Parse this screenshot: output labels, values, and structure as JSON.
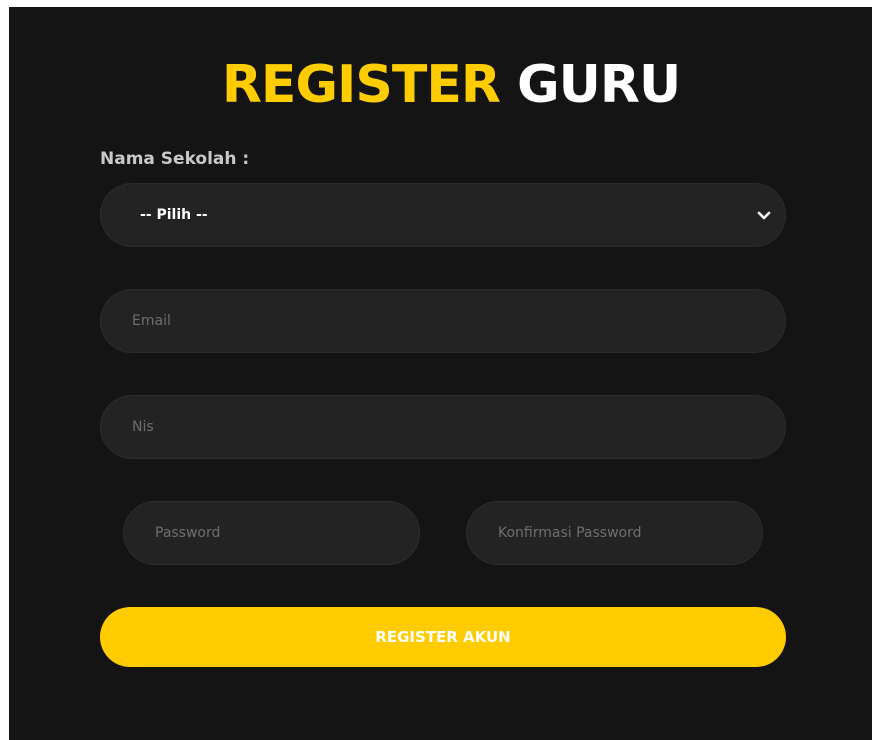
{
  "title": {
    "accent": "REGISTER",
    "rest": "GURU"
  },
  "form": {
    "school_label": "Nama Sekolah :",
    "school_select_value": "-- Pilih --",
    "email_placeholder": "Email",
    "nis_placeholder": "Nis",
    "password_placeholder": "Password",
    "confirm_password_placeholder": "Konfirmasi Password",
    "submit_label": "REGISTER AKUN"
  },
  "colors": {
    "background": "#141414",
    "accent": "#ffcc00",
    "field": "#232323",
    "placeholder": "#6e6e6e"
  }
}
